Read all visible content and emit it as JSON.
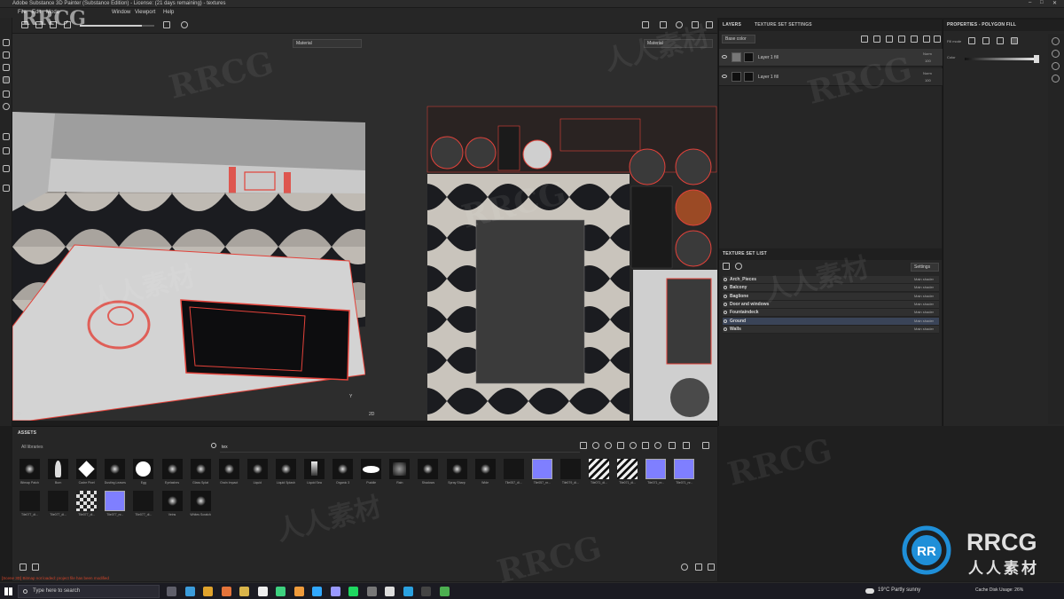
{
  "window": {
    "title": "Adobe Substance 3D Painter (Substance Edition) - License: (21 days remaining) - textures",
    "controls": [
      "–",
      "□",
      "✕"
    ]
  },
  "menu": [
    "File",
    "Edit",
    "Mode",
    "Window",
    "Viewport",
    "Help"
  ],
  "viewport3d": {
    "material_dropdown": "Material",
    "label": "3D",
    "axis": "Y"
  },
  "viewport2d": {
    "material_dropdown": "Material",
    "label": "2D"
  },
  "layers_panel": {
    "tabs": [
      "LAYERS",
      "TEXTURE SET SETTINGS"
    ],
    "mode": "Base color",
    "layers": [
      {
        "name": "Layer 1 fill",
        "blend": "Norm",
        "opacity": "100"
      },
      {
        "name": "Layer 1 fill",
        "blend": "Norm",
        "opacity": "100"
      }
    ]
  },
  "texture_set_list": {
    "title": "TEXTURE SET LIST",
    "settings_label": "Settings",
    "items": [
      {
        "name": "Arch_Pieces",
        "shader": "Main shader"
      },
      {
        "name": "Balcony",
        "shader": "Main shader"
      },
      {
        "name": "Baglione",
        "shader": "Main shader"
      },
      {
        "name": "Door and windows",
        "shader": "Main shader"
      },
      {
        "name": "Fountaindeck",
        "shader": "Main shader"
      },
      {
        "name": "Ground",
        "shader": "Main shader"
      },
      {
        "name": "Walls",
        "shader": "Main shader"
      }
    ],
    "selected_index": 5
  },
  "properties_panel": {
    "title": "PROPERTIES - POLYGON FILL",
    "fill_mode_label": "Fill mode",
    "color_label": "Color"
  },
  "assets_panel": {
    "title": "ASSETS",
    "library": "All libraries",
    "search_value": "tex",
    "row1": [
      {
        "label": "Bitmap Patch",
        "kind": "burst"
      },
      {
        "label": "Burn",
        "kind": "flame"
      },
      {
        "label": "Cadre Pixel",
        "kind": "diamond"
      },
      {
        "label": "Dusting Leaves",
        "kind": "splat"
      },
      {
        "label": "Egg",
        "kind": "blob"
      },
      {
        "label": "Eyelashes",
        "kind": "scratch"
      },
      {
        "label": "Glass Splat",
        "kind": "noise"
      },
      {
        "label": "Grain Impact",
        "kind": "star"
      },
      {
        "label": "Liquid",
        "kind": "drop"
      },
      {
        "label": "Liquid Splash",
        "kind": "splash"
      },
      {
        "label": "Liquid Sea",
        "kind": "drip"
      },
      {
        "label": "Organic 3",
        "kind": "flake"
      },
      {
        "label": "Puddle",
        "kind": "ellipse"
      },
      {
        "label": "Rain",
        "kind": "rain"
      },
      {
        "label": "Shadows",
        "kind": "dots"
      },
      {
        "label": "Spray Sharp",
        "kind": "spray"
      },
      {
        "label": "Wide",
        "kind": "streak"
      },
      {
        "label": "Tile057_di...",
        "kind": "dark"
      },
      {
        "label": "Tile057_nr...",
        "kind": "normal"
      },
      {
        "label": "Tile079_di...",
        "kind": "dark"
      },
      {
        "label": "Tile071_di...",
        "kind": "zigzag"
      },
      {
        "label": "Tile071_di...",
        "kind": "zigzag"
      },
      {
        "label": "Tile071_nr...",
        "kind": "normal"
      },
      {
        "label": "Tile071_nr...",
        "kind": "normal"
      }
    ],
    "row2": [
      {
        "label": "Tile077_di...",
        "kind": "dark"
      },
      {
        "label": "Tile077_di...",
        "kind": "dark"
      },
      {
        "label": "Tile077_di...",
        "kind": "checker"
      },
      {
        "label": "Tile077_nr...",
        "kind": "normal"
      },
      {
        "label": "Tile077_di...",
        "kind": "dark"
      },
      {
        "label": "Veins",
        "kind": "veins"
      },
      {
        "label": "Whites Scratch",
        "kind": "speck"
      }
    ]
  },
  "status_error": "[Scene 3D] Bitmap not loaded: project file has been modified",
  "taskbar": {
    "search_placeholder": "Type here to search",
    "weather": "19°C  Partly sunny",
    "time_text": "Cache Disk Usage: 26%",
    "pinned": [
      "task-view",
      "edge",
      "chrome",
      "firefox",
      "folder",
      "unreal",
      "painter",
      "substance-designer",
      "photoshop",
      "premiere",
      "spotify",
      "obs",
      "github",
      "photos",
      "terminal",
      "chrome2"
    ],
    "icon_colors": [
      "#5f5f6a",
      "#3b9cdb",
      "#e0a32c",
      "#e5743a",
      "#d9b44a",
      "#eeeeee",
      "#3dd17f",
      "#ef9b3b",
      "#31a8ff",
      "#9999ff",
      "#1ed760",
      "#777777",
      "#dddddd",
      "#2aa1e0",
      "#444444",
      "#4caf50"
    ]
  },
  "colors": {
    "highlight_red": "#e2423a",
    "selected_row": "#3a4458",
    "normal_map": "#7f7fff"
  },
  "watermark": {
    "text_latin": "RRCG",
    "text_cjk": "人人素材"
  }
}
